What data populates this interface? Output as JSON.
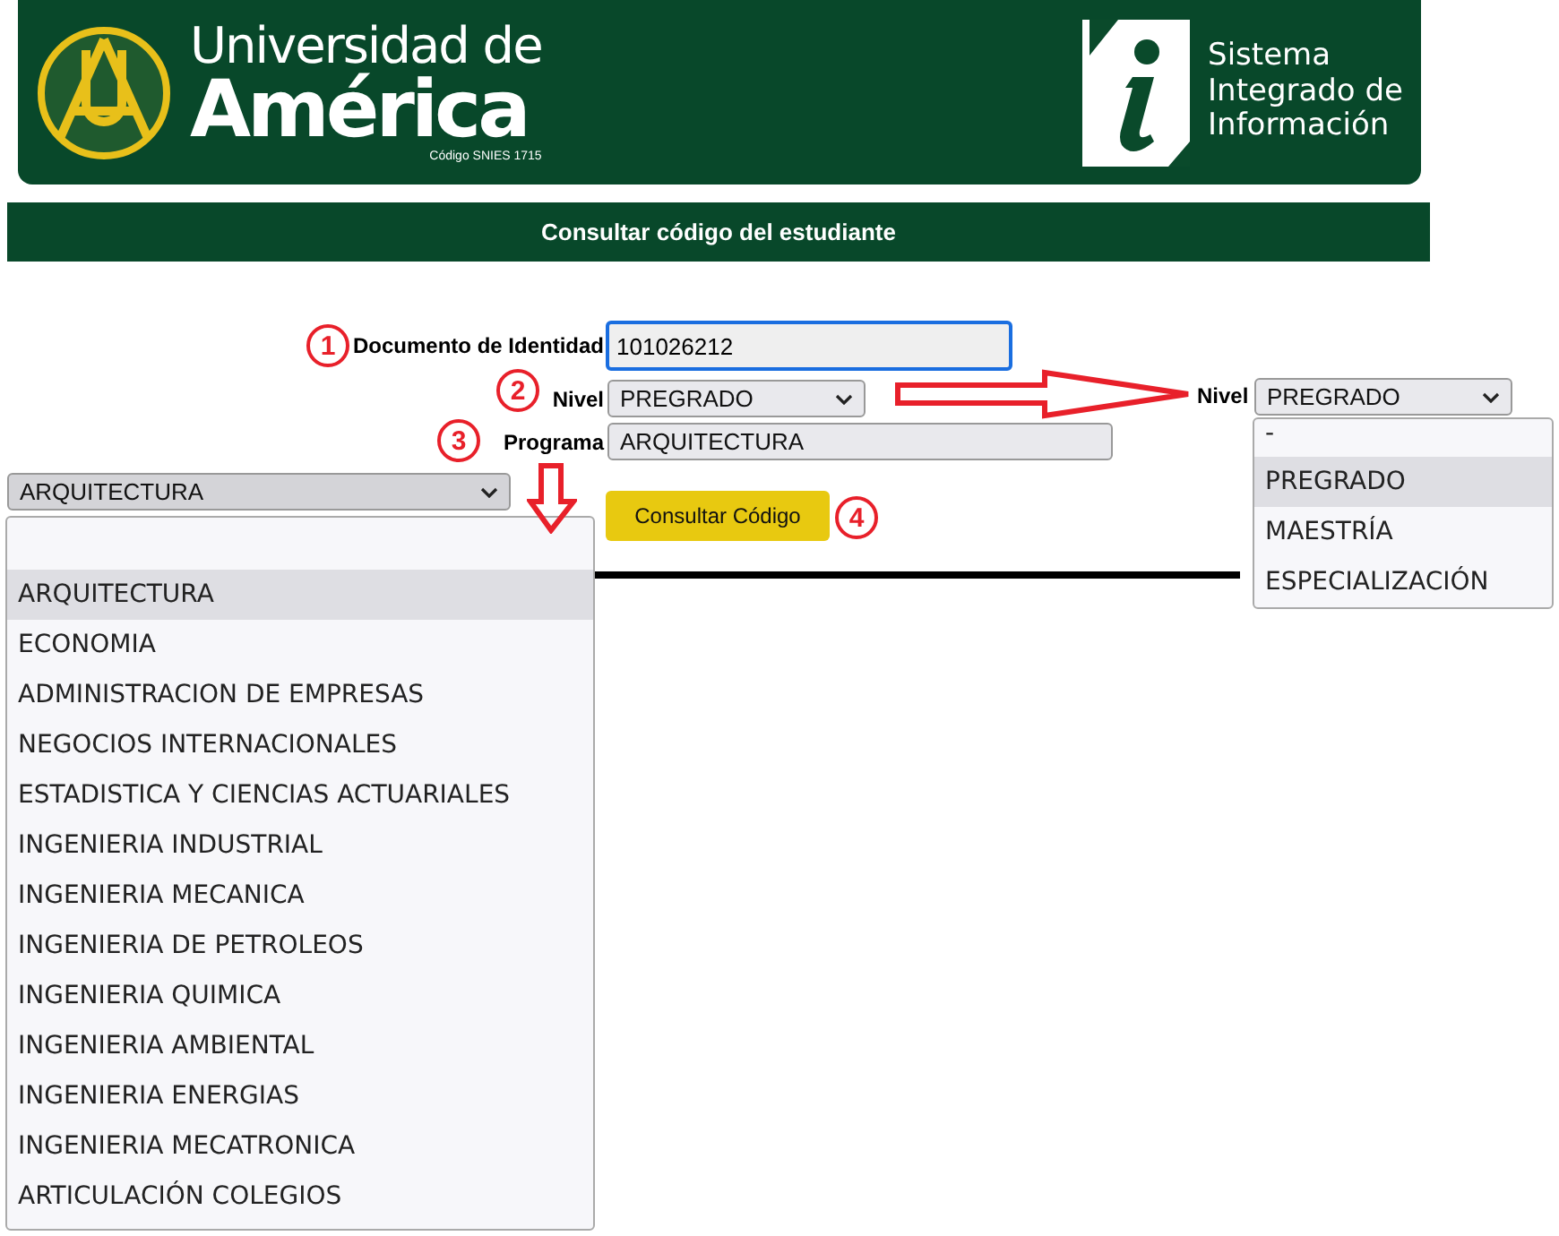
{
  "header": {
    "university_line1": "Universidad de",
    "university_line2": "América",
    "snies_code": "Código SNIES 1715",
    "system_name_lines": [
      "Sistema",
      "Integrado de",
      "Información"
    ]
  },
  "title_bar": {
    "title": "Consultar código del estudiante"
  },
  "form": {
    "document": {
      "label": "Documento de Identidad",
      "value": "101026212"
    },
    "nivel": {
      "label": "Nivel",
      "value": "PREGRADO"
    },
    "programa": {
      "label": "Programa",
      "value": "ARQUITECTURA"
    },
    "submit_button": "Consultar Código"
  },
  "step_markers": [
    "1",
    "2",
    "3",
    "4"
  ],
  "nivel_dropdown": {
    "label": "Nivel",
    "value": "PREGRADO",
    "options": [
      {
        "label": "-",
        "selected": false
      },
      {
        "label": "PREGRADO",
        "selected": true
      },
      {
        "label": "MAESTRÍA",
        "selected": false
      },
      {
        "label": "ESPECIALIZACIÓN",
        "selected": false
      }
    ]
  },
  "programa_dropdown": {
    "value": "ARQUITECTURA",
    "options": [
      {
        "label": "ARQUITECTURA",
        "selected": true
      },
      {
        "label": "ECONOMIA",
        "selected": false
      },
      {
        "label": "ADMINISTRACION DE EMPRESAS",
        "selected": false
      },
      {
        "label": "NEGOCIOS INTERNACIONALES",
        "selected": false
      },
      {
        "label": "ESTADISTICA Y CIENCIAS ACTUARIALES",
        "selected": false
      },
      {
        "label": "INGENIERIA INDUSTRIAL",
        "selected": false
      },
      {
        "label": "INGENIERIA MECANICA",
        "selected": false
      },
      {
        "label": "INGENIERIA DE PETROLEOS",
        "selected": false
      },
      {
        "label": "INGENIERIA QUIMICA",
        "selected": false
      },
      {
        "label": "INGENIERIA AMBIENTAL",
        "selected": false
      },
      {
        "label": "INGENIERIA ENERGIAS",
        "selected": false
      },
      {
        "label": "INGENIERIA MECATRONICA",
        "selected": false
      },
      {
        "label": "ARTICULACIÓN COLEGIOS",
        "selected": false
      }
    ]
  }
}
